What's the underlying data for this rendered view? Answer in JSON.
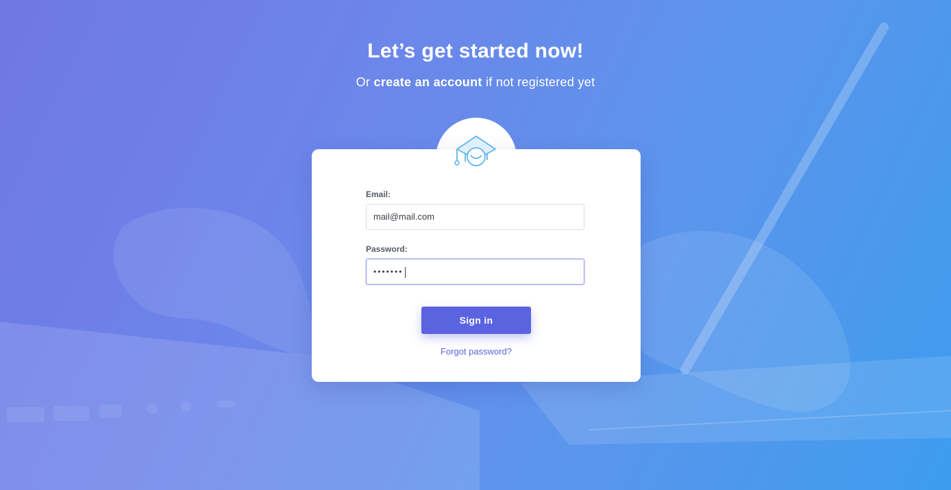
{
  "header": {
    "title": "Let’s get started now!",
    "subtitle_prefix": "Or ",
    "subtitle_link": "create an account",
    "subtitle_suffix": " if not registered yet"
  },
  "badge": {
    "icon": "graduation-cap-icon"
  },
  "form": {
    "email_label": "Email:",
    "email_value": "mail@mail.com",
    "password_label": "Password:",
    "password_value": "•••••••",
    "signin_label": "Sign in",
    "forgot_label": "Forgot password?"
  },
  "colors": {
    "accent": "#5a63e0",
    "background_start": "#7077e4",
    "background_end": "#3d9cee",
    "icon": "#5fb4ee"
  }
}
